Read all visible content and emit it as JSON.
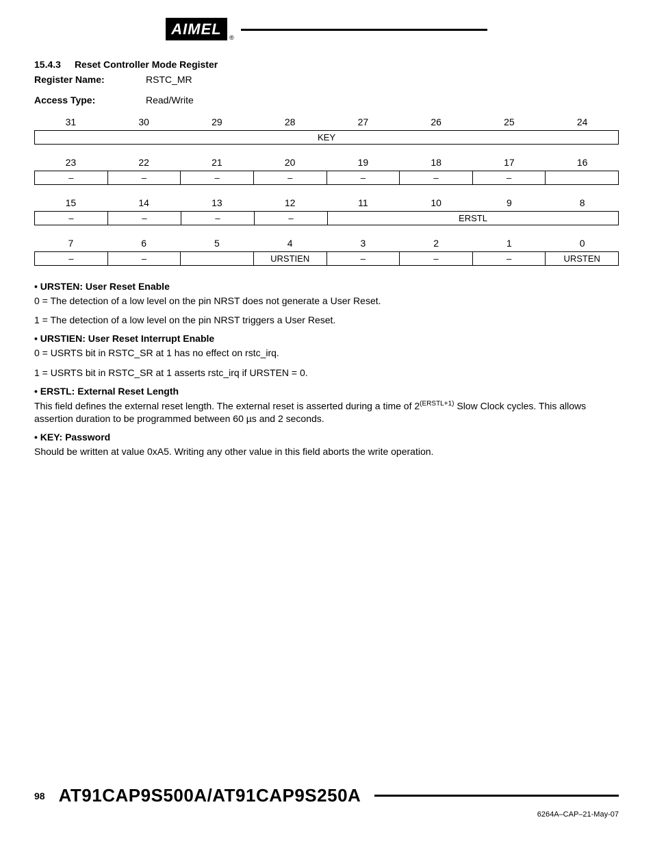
{
  "logo_text": "AIMEL",
  "section": {
    "number": "15.4.3",
    "title": "Reset Controller Mode Register"
  },
  "meta": {
    "reg_name_label": "Register Name:",
    "reg_name": "RSTC_MR",
    "access_label": "Access Type:",
    "access": "Read/Write"
  },
  "bits": {
    "rows": [
      {
        "nums": [
          "31",
          "30",
          "29",
          "28",
          "27",
          "26",
          "25",
          "24"
        ],
        "fields": [
          {
            "label": "KEY",
            "span": 8
          }
        ]
      },
      {
        "nums": [
          "23",
          "22",
          "21",
          "20",
          "19",
          "18",
          "17",
          "16"
        ],
        "fields": [
          {
            "label": "–",
            "span": 1
          },
          {
            "label": "–",
            "span": 1
          },
          {
            "label": "–",
            "span": 1
          },
          {
            "label": "–",
            "span": 1
          },
          {
            "label": "–",
            "span": 1
          },
          {
            "label": "–",
            "span": 1
          },
          {
            "label": "–",
            "span": 1
          },
          {
            "label": "",
            "span": 1
          }
        ]
      },
      {
        "nums": [
          "15",
          "14",
          "13",
          "12",
          "11",
          "10",
          "9",
          "8"
        ],
        "fields": [
          {
            "label": "–",
            "span": 1
          },
          {
            "label": "–",
            "span": 1
          },
          {
            "label": "–",
            "span": 1
          },
          {
            "label": "–",
            "span": 1
          },
          {
            "label": "ERSTL",
            "span": 4
          }
        ]
      },
      {
        "nums": [
          "7",
          "6",
          "5",
          "4",
          "3",
          "2",
          "1",
          "0"
        ],
        "fields": [
          {
            "label": "–",
            "span": 1
          },
          {
            "label": "–",
            "span": 1
          },
          {
            "label": "",
            "span": 1
          },
          {
            "label": "URSTIEN",
            "span": 1
          },
          {
            "label": "–",
            "span": 1
          },
          {
            "label": "–",
            "span": 1
          },
          {
            "label": "–",
            "span": 1
          },
          {
            "label": "URSTEN",
            "span": 1
          }
        ]
      }
    ]
  },
  "desc": {
    "ursten_head": "URSTEN: User Reset Enable",
    "ursten_0": "0 = The detection of a low level on the pin NRST does not generate a User Reset.",
    "ursten_1": "1 = The detection of a low level on the pin NRST triggers a User Reset.",
    "urstien_head": "URSTIEN: User Reset Interrupt Enable",
    "urstien_0": "0 = USRTS bit in RSTC_SR at 1 has no effect on rstc_irq.",
    "urstien_1": "1 = USRTS bit in RSTC_SR at 1 asserts rstc_irq if URSTEN = 0.",
    "erstl_head": "ERSTL: External Reset Length",
    "erstl_p1a": "This field defines the external reset length. The external reset is asserted during a time of 2",
    "erstl_sup": "(ERSTL+1)",
    "erstl_p1b": " Slow Clock cycles. This allows assertion duration to be programmed between 60 µs and 2 seconds.",
    "key_head": "KEY: Password",
    "key_p": "Should be written at value 0xA5. Writing any other value in this field aborts the write operation."
  },
  "footer": {
    "page": "98",
    "title": "AT91CAP9S500A/AT91CAP9S250A",
    "docid": "6264A–CAP–21-May-07"
  }
}
